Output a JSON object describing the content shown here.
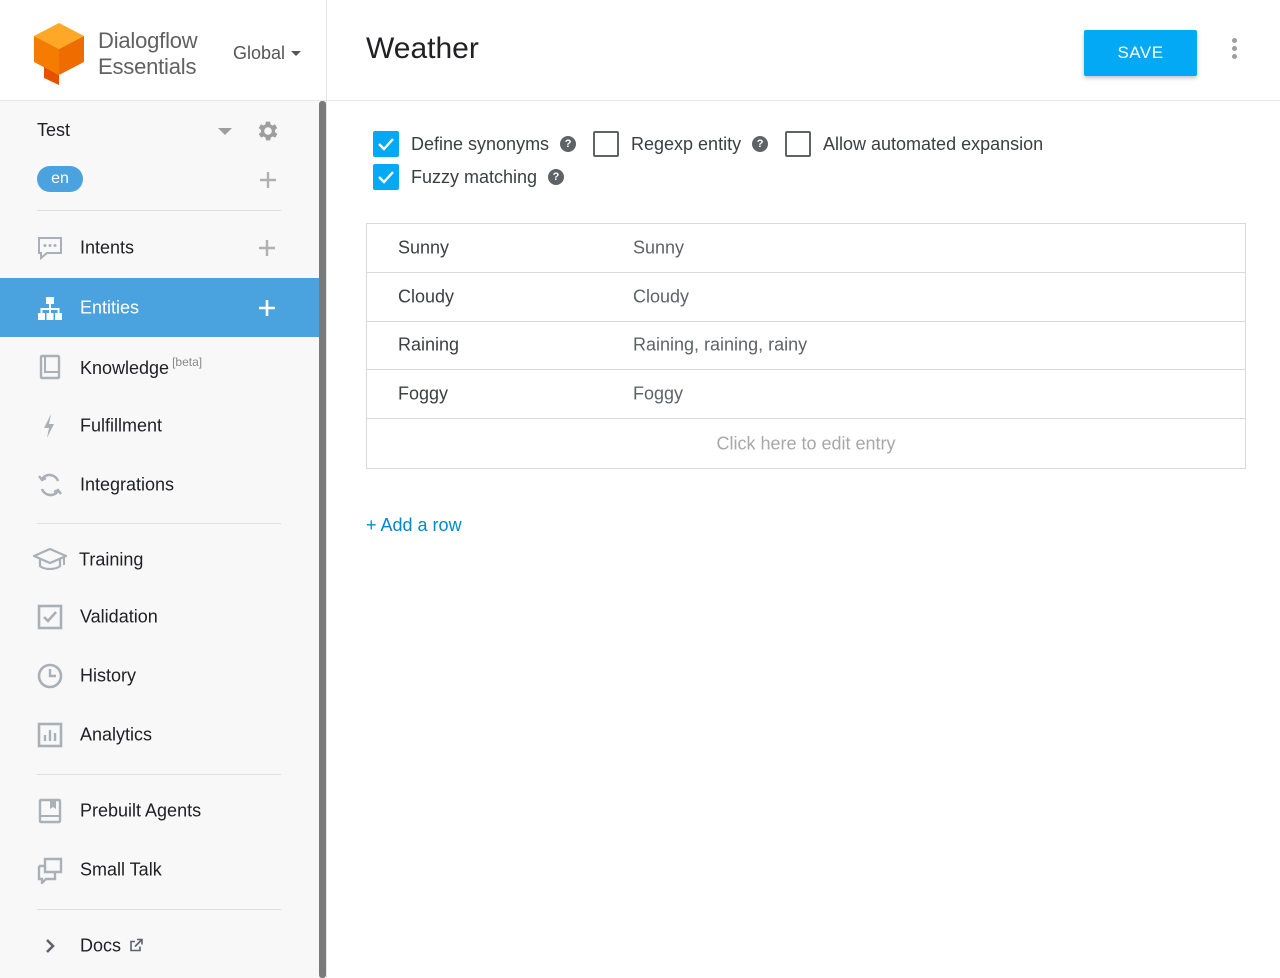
{
  "brand": {
    "line1": "Dialogflow",
    "line2": "Essentials",
    "region": "Global"
  },
  "agent": {
    "name": "Test",
    "language": "en"
  },
  "nav": [
    {
      "label": "Intents",
      "icon": "chat-icon",
      "has_add": true
    },
    {
      "label": "Entities",
      "icon": "hierarchy-icon",
      "has_add": true,
      "active": true
    },
    {
      "label": "Knowledge",
      "badge": "[beta]",
      "icon": "book-icon"
    },
    {
      "label": "Fulfillment",
      "icon": "bolt-icon"
    },
    {
      "label": "Integrations",
      "icon": "sync-icon"
    },
    {
      "label": "Training",
      "icon": "graduation-cap-icon"
    },
    {
      "label": "Validation",
      "icon": "checkbox-icon"
    },
    {
      "label": "History",
      "icon": "clock-icon"
    },
    {
      "label": "Analytics",
      "icon": "bar-chart-icon"
    },
    {
      "label": "Prebuilt Agents",
      "icon": "bookmark-book-icon"
    },
    {
      "label": "Small Talk",
      "icon": "chat-bubbles-icon"
    },
    {
      "label": "Docs",
      "icon": "chevron-right-icon"
    }
  ],
  "header": {
    "title": "Weather",
    "save_label": "SAVE"
  },
  "options": [
    {
      "label": "Define synonyms",
      "checked": true,
      "help": "?"
    },
    {
      "label": "Regexp entity",
      "checked": false,
      "help": "?"
    },
    {
      "label": "Allow automated expansion",
      "checked": false
    },
    {
      "label": "Fuzzy matching",
      "checked": true,
      "help": "?"
    }
  ],
  "entries": [
    {
      "reference": "Sunny",
      "synonyms": "Sunny"
    },
    {
      "reference": "Cloudy",
      "synonyms": "Cloudy"
    },
    {
      "reference": "Raining",
      "synonyms": "Raining, raining, rainy"
    },
    {
      "reference": "Foggy",
      "synonyms": "Foggy"
    }
  ],
  "edit_hint": "Click here to edit entry",
  "add_row_label": "+ Add a row",
  "colors": {
    "accent": "#03a9f4",
    "active_nav": "#4aa3df",
    "link": "#0288d1"
  }
}
